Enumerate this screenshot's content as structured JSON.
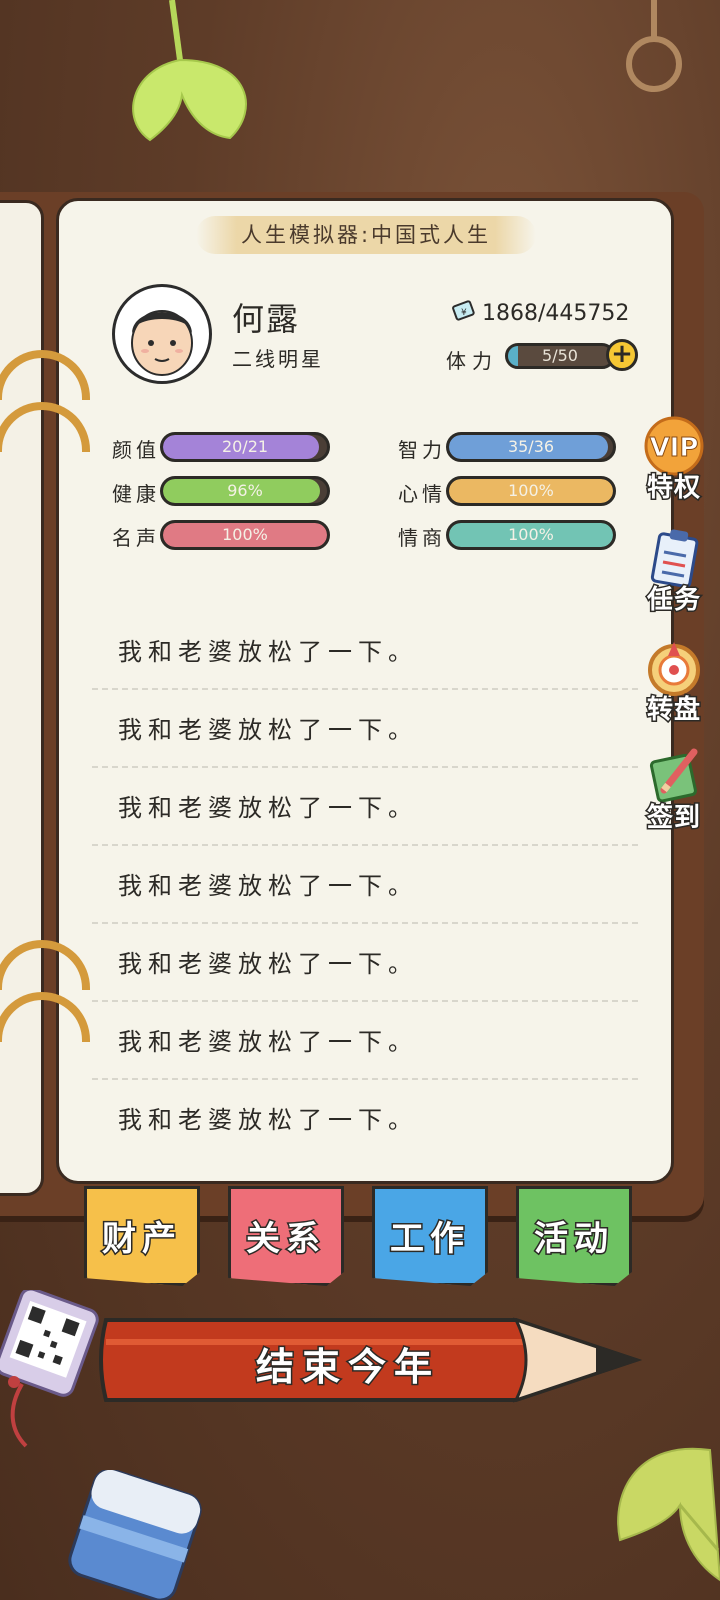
{
  "title": "人生模拟器:中国式人生",
  "profile": {
    "name": "何露",
    "job": "二线明星",
    "money": "1868/445752",
    "stamina_label": "体力",
    "stamina": {
      "text": "5/50",
      "fraction": 0.1
    }
  },
  "stats": [
    {
      "label": "颜值",
      "text": "20/21",
      "fraction": 0.95,
      "color": "#a483d8"
    },
    {
      "label": "智力",
      "text": "35/36",
      "fraction": 0.97,
      "color": "#6f9fd8"
    },
    {
      "label": "健康",
      "text": "96%",
      "fraction": 0.96,
      "color": "#90cc5e"
    },
    {
      "label": "心情",
      "text": "100%",
      "fraction": 1.0,
      "color": "#ebb862"
    },
    {
      "label": "名声",
      "text": "100%",
      "fraction": 1.0,
      "color": "#e07a84"
    },
    {
      "label": "情商",
      "text": "100%",
      "fraction": 1.0,
      "color": "#72c4b4"
    }
  ],
  "diary": [
    "我和老婆放松了一下。",
    "我和老婆放松了一下。",
    "我和老婆放松了一下。",
    "我和老婆放松了一下。",
    "我和老婆放松了一下。",
    "我和老婆放松了一下。",
    "我和老婆放松了一下。"
  ],
  "side_menu": [
    {
      "label": "特权",
      "badge": "VIP",
      "icon": "vip-icon"
    },
    {
      "label": "任务",
      "icon": "clipboard-icon"
    },
    {
      "label": "转盘",
      "icon": "wheel-icon"
    },
    {
      "label": "签到",
      "icon": "checkin-icon"
    }
  ],
  "tabs": [
    {
      "label": "财产",
      "color": "#f6c04a"
    },
    {
      "label": "关系",
      "color": "#ee6e78"
    },
    {
      "label": "工作",
      "color": "#4aa6e6"
    },
    {
      "label": "活动",
      "color": "#6ec262"
    }
  ],
  "end_year_label": "结束今年"
}
